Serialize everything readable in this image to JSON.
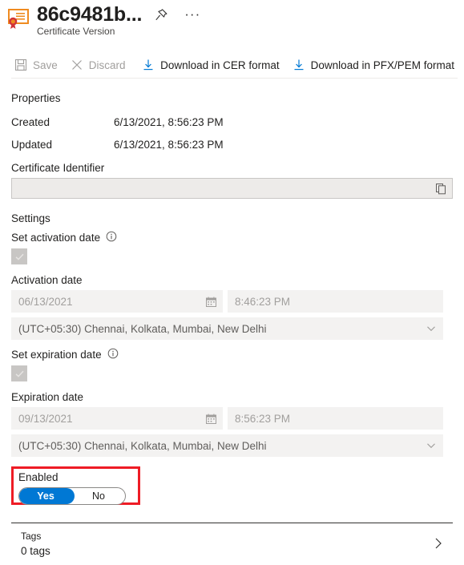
{
  "header": {
    "icon": "certificate-icon",
    "title": "86c9481b...",
    "subtitle": "Certificate Version",
    "pin_icon": "pin-icon",
    "more_icon": "ellipsis-icon",
    "more_label": "···"
  },
  "toolbar": {
    "save_label": "Save",
    "save_icon": "save-icon",
    "save_disabled": true,
    "discard_label": "Discard",
    "discard_icon": "close-icon",
    "discard_disabled": true,
    "download_cer_label": "Download in CER format",
    "download_cer_icon": "download-icon",
    "download_pfx_label": "Download in PFX/PEM format",
    "download_pfx_icon": "download-icon"
  },
  "properties": {
    "section_title": "Properties",
    "rows": [
      {
        "key": "Created",
        "value": "6/13/2021, 8:56:23 PM"
      },
      {
        "key": "Updated",
        "value": "6/13/2021, 8:56:23 PM"
      }
    ],
    "identifier_label": "Certificate Identifier",
    "identifier_value": "",
    "identifier_copy_icon": "copy-icon"
  },
  "settings": {
    "section_title": "Settings",
    "activation": {
      "toggle_label": "Set activation date",
      "info_icon": "info-icon",
      "checkbox_checked": true,
      "checkbox_disabled": true,
      "date_label": "Activation date",
      "date_value": "06/13/2021",
      "calendar_icon": "calendar-icon",
      "time_value": "8:46:23 PM",
      "timezone_value": "(UTC+05:30) Chennai, Kolkata, Mumbai, New Delhi",
      "timezone_chevron_icon": "chevron-down-icon"
    },
    "expiration": {
      "toggle_label": "Set expiration date",
      "info_icon": "info-icon",
      "checkbox_checked": true,
      "checkbox_disabled": true,
      "date_label": "Expiration date",
      "date_value": "09/13/2021",
      "calendar_icon": "calendar-icon",
      "time_value": "8:56:23 PM",
      "timezone_value": "(UTC+05:30) Chennai, Kolkata, Mumbai, New Delhi",
      "timezone_chevron_icon": "chevron-down-icon"
    },
    "enabled": {
      "label": "Enabled",
      "yes_label": "Yes",
      "no_label": "No",
      "selected": "Yes",
      "highlight_color": "#ee1c25",
      "accent_color": "#0078d4"
    }
  },
  "tags": {
    "title": "Tags",
    "count_label": "0 tags",
    "chevron_icon": "chevron-right-icon"
  }
}
